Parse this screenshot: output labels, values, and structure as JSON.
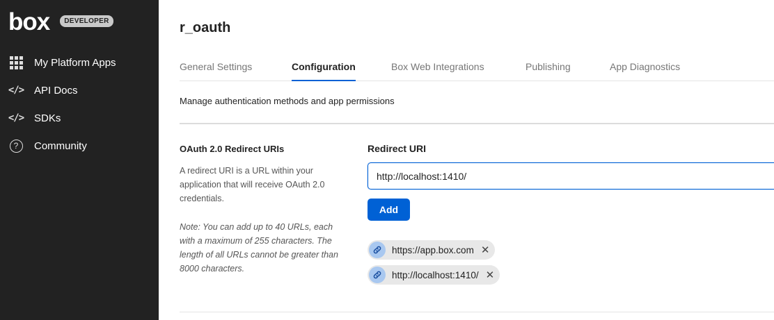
{
  "sidebar": {
    "logo": "box",
    "badge": "DEVELOPER",
    "items": [
      {
        "label": "My Platform Apps",
        "icon": "grid-icon"
      },
      {
        "label": "API Docs",
        "icon": "code-icon"
      },
      {
        "label": "SDKs",
        "icon": "code-icon"
      },
      {
        "label": "Community",
        "icon": "help-circle-icon"
      }
    ]
  },
  "app": {
    "title": "r_oauth",
    "tabs": [
      {
        "label": "General Settings",
        "active": false
      },
      {
        "label": "Configuration",
        "active": true
      },
      {
        "label": "Box Web Integrations",
        "active": false
      },
      {
        "label": "Publishing",
        "active": false
      },
      {
        "label": "App Diagnostics",
        "active": false
      }
    ],
    "subtitle": "Manage authentication methods and app permissions"
  },
  "redirect_section": {
    "title": "OAuth 2.0 Redirect URIs",
    "description": "A redirect URI is a URL within your application that will receive OAuth 2.0 credentials.",
    "note": "Note: You can add up to 40 URLs, each with a maximum of 255 characters. The length of all URLs cannot be greater than 8000 characters.",
    "field_label": "Redirect URI",
    "input_value": "http://localhost:1410/",
    "add_label": "Add",
    "uris": [
      "https://app.box.com",
      "http://localhost:1410/"
    ]
  },
  "colors": {
    "sidebar_bg": "#222222",
    "accent": "#0061d5",
    "pill_bg": "#e8e8e8",
    "link_icon_bg": "#a9c8f0"
  }
}
